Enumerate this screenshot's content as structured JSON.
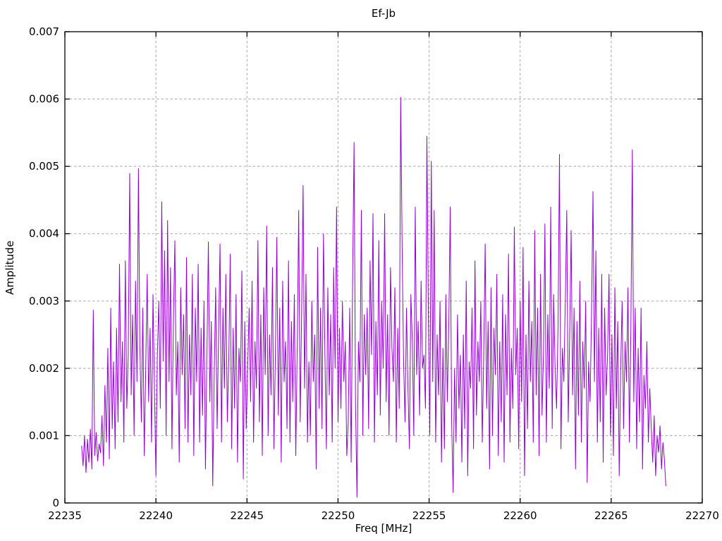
{
  "title": "Ef-Jb",
  "axes": {
    "x": {
      "label": "Freq [MHz]",
      "min": 22235,
      "max": 22270
    },
    "y": {
      "label": "Amplitude",
      "min": 0,
      "max": 0.007
    }
  },
  "colors": {
    "line": "#9400d3",
    "grid": "#a8a8a8",
    "border": "#000000",
    "text": "#000000",
    "background": "#ffffff"
  },
  "chart_data": {
    "type": "line",
    "title": "Ef-Jb",
    "xlabel": "Freq [MHz]",
    "ylabel": "Amplitude",
    "xlim": [
      22235,
      22270
    ],
    "ylim": [
      0,
      0.007
    ],
    "x_ticks": [
      22235,
      22240,
      22245,
      22250,
      22255,
      22260,
      22265,
      22270
    ],
    "x_tick_labels": [
      "22235",
      "22240",
      "22245",
      "22250",
      "22255",
      "22260",
      "22265",
      "22270"
    ],
    "y_ticks": [
      0,
      0.001,
      0.002,
      0.003,
      0.004,
      0.005,
      0.006,
      0.007
    ],
    "y_tick_labels": [
      "0",
      "0.001",
      "0.002",
      "0.003",
      "0.004",
      "0.005",
      "0.006",
      "0.007"
    ],
    "grid": true,
    "grid_style": "dotted-gray",
    "legend": "none",
    "series_name": "Ef-Jb",
    "line_color": "#9400d3",
    "data_x_start": 22235.92,
    "data_x_step": 0.08,
    "value_scale": 0.001,
    "values_unit": "amplitude x 0.001",
    "values": [
      0.85,
      0.55,
      1.0,
      0.45,
      0.95,
      0.6,
      1.1,
      0.5,
      2.87,
      0.7,
      1.05,
      0.62,
      0.88,
      0.74,
      1.3,
      0.55,
      1.75,
      0.9,
      2.3,
      0.65,
      2.9,
      1.1,
      2.1,
      0.8,
      2.6,
      1.2,
      3.55,
      1.5,
      2.4,
      0.9,
      3.6,
      1.4,
      2.2,
      4.9,
      1.6,
      2.8,
      1.0,
      3.3,
      1.8,
      4.97,
      2.3,
      1.2,
      2.9,
      0.7,
      2.0,
      3.4,
      1.5,
      2.6,
      0.9,
      3.1,
      1.7,
      0.4,
      2.2,
      3.0,
      1.4,
      4.48,
      2.1,
      3.75,
      1.0,
      4.2,
      1.8,
      3.5,
      0.8,
      2.7,
      3.9,
      1.6,
      2.4,
      0.6,
      3.2,
      1.9,
      2.8,
      1.1,
      3.65,
      0.9,
      2.5,
      1.6,
      3.4,
      0.7,
      2.9,
      1.8,
      3.55,
      0.9,
      2.6,
      1.3,
      3.0,
      0.5,
      2.2,
      3.88,
      1.5,
      2.7,
      0.25,
      1.9,
      3.2,
      1.1,
      2.5,
      3.85,
      0.9,
      2.9,
      1.7,
      3.4,
      1.2,
      2.1,
      3.7,
      0.8,
      2.6,
      1.4,
      3.1,
      0.6,
      2.3,
      1.8,
      3.45,
      0.35,
      2.7,
      1.1,
      2.0,
      2.9,
      1.5,
      3.3,
      0.9,
      2.4,
      1.7,
      3.9,
      1.2,
      2.8,
      0.7,
      3.2,
      1.9,
      4.12,
      1.0,
      2.5,
      1.6,
      3.5,
      0.8,
      2.2,
      3.95,
      1.3,
      2.9,
      0.6,
      3.3,
      1.8,
      2.4,
      1.1,
      3.6,
      0.9,
      2.7,
      1.5,
      3.1,
      0.7,
      2.3,
      4.35,
      1.2,
      2.8,
      4.72,
      1.7,
      3.4,
      0.9,
      2.1,
      1.0,
      3.0,
      1.8,
      2.5,
      0.5,
      3.8,
      1.4,
      2.9,
      1.1,
      4.0,
      2.2,
      0.8,
      3.2,
      1.6,
      2.8,
      0.9,
      3.5,
      2.0,
      4.4,
      1.2,
      2.6,
      1.4,
      3.0,
      1.8,
      2.4,
      0.7,
      1.2,
      2.9,
      0.6,
      3.3,
      5.36,
      1.5,
      0.08,
      2.4,
      1.8,
      4.35,
      1.0,
      2.8,
      1.9,
      2.9,
      1.1,
      3.6,
      2.2,
      4.3,
      0.9,
      2.7,
      1.6,
      3.9,
      1.3,
      3.0,
      2.0,
      4.3,
      1.5,
      2.8,
      1.0,
      3.5,
      2.3,
      1.8,
      3.2,
      0.9,
      2.6,
      1.4,
      6.03,
      3.8,
      2.1,
      1.2,
      2.9,
      1.7,
      0.8,
      3.1,
      2.4,
      1.0,
      4.4,
      1.9,
      2.7,
      1.3,
      3.3,
      2.0,
      2.2,
      1.4,
      5.45,
      2.8,
      1.0,
      5.08,
      1.8,
      4.35,
      0.9,
      2.5,
      1.6,
      3.0,
      0.6,
      2.3,
      0.8,
      3.1,
      1.5,
      2.6,
      4.4,
      1.2,
      0.15,
      2.0,
      0.9,
      2.8,
      1.4,
      2.2,
      0.6,
      2.5,
      1.1,
      3.3,
      0.4,
      2.1,
      1.7,
      2.9,
      0.8,
      3.6,
      1.3,
      2.4,
      1.8,
      3.0,
      0.9,
      2.2,
      3.85,
      1.4,
      2.7,
      0.5,
      3.2,
      1.0,
      2.6,
      1.9,
      3.4,
      0.7,
      2.4,
      1.2,
      3.1,
      0.6,
      2.8,
      1.6,
      3.7,
      0.9,
      2.3,
      1.4,
      4.1,
      1.9,
      2.6,
      0.8,
      3.0,
      1.5,
      3.8,
      0.4,
      2.5,
      1.1,
      3.3,
      1.8,
      2.7,
      0.9,
      4.05,
      1.6,
      2.9,
      0.7,
      3.4,
      1.3,
      2.2,
      4.15,
      0.9,
      2.8,
      1.7,
      4.4,
      1.1,
      3.1,
      2.0,
      1.4,
      2.6,
      5.18,
      0.8,
      2.3,
      1.8,
      3.0,
      4.35,
      1.2,
      2.5,
      4.05,
      1.6,
      2.9,
      0.5,
      2.7,
      1.3,
      3.3,
      0.9,
      2.4,
      1.7,
      3.0,
      0.3,
      2.1,
      1.5,
      2.8,
      4.63,
      1.8,
      3.75,
      0.9,
      2.6,
      1.2,
      3.4,
      0.6,
      2.9,
      1.6,
      2.2,
      3.4,
      1.0,
      2.5,
      0.7,
      3.2,
      1.4,
      2.7,
      0.4,
      2.0,
      3.0,
      1.1,
      2.4,
      1.8,
      3.2,
      0.9,
      2.6,
      5.25,
      1.5,
      2.9,
      0.8,
      2.3,
      1.2,
      2.9,
      0.5,
      1.9,
      1.4,
      2.4,
      0.9,
      1.7,
      1.1,
      0.6,
      1.3,
      0.4,
      1.0,
      0.75,
      1.15,
      0.5,
      0.9,
      0.65,
      0.25
    ],
    "notable_peaks": [
      {
        "freq_mhz": 22236.56,
        "amplitude": 0.00287
      },
      {
        "freq_mhz": 22238.5,
        "amplitude": 0.0049
      },
      {
        "freq_mhz": 22239.48,
        "amplitude": 0.00497
      },
      {
        "freq_mhz": 22240.72,
        "amplitude": 0.00448
      },
      {
        "freq_mhz": 22246.24,
        "amplitude": 0.00412
      },
      {
        "freq_mhz": 22248.32,
        "amplitude": 0.00472
      },
      {
        "freq_mhz": 22250.88,
        "amplitude": 0.00536
      },
      {
        "freq_mhz": 22253.44,
        "amplitude": 0.00603
      },
      {
        "freq_mhz": 22254.88,
        "amplitude": 0.00545
      },
      {
        "freq_mhz": 22255.12,
        "amplitude": 0.00508
      },
      {
        "freq_mhz": 22262.16,
        "amplitude": 0.00518
      },
      {
        "freq_mhz": 22264.0,
        "amplitude": 0.00463
      },
      {
        "freq_mhz": 22266.16,
        "amplitude": 0.00525
      }
    ]
  }
}
